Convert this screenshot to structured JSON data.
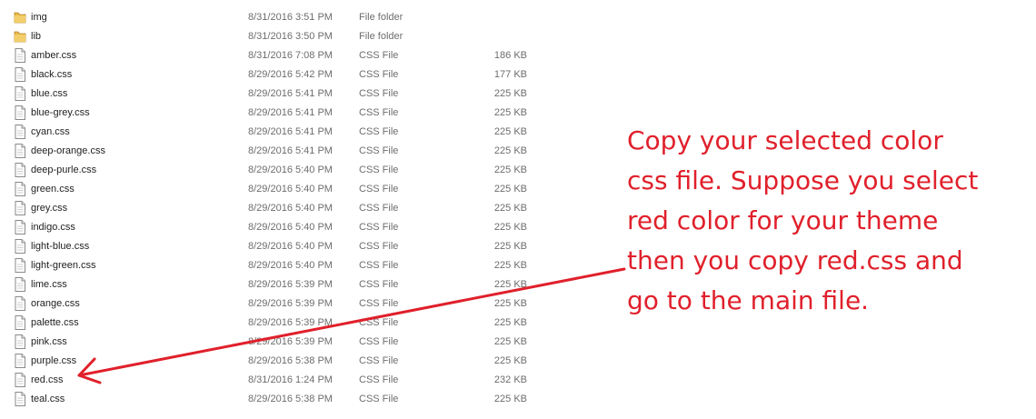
{
  "files": [
    {
      "name": "img",
      "date": "8/31/2016 3:51 PM",
      "type": "File folder",
      "size": "",
      "icon": "folder-icon"
    },
    {
      "name": "lib",
      "date": "8/31/2016 3:50 PM",
      "type": "File folder",
      "size": "",
      "icon": "folder-icon"
    },
    {
      "name": "amber.css",
      "date": "8/31/2016 7:08 PM",
      "type": "CSS File",
      "size": "186 KB",
      "icon": "file-icon"
    },
    {
      "name": "black.css",
      "date": "8/29/2016 5:42 PM",
      "type": "CSS File",
      "size": "177 KB",
      "icon": "file-icon"
    },
    {
      "name": "blue.css",
      "date": "8/29/2016 5:41 PM",
      "type": "CSS File",
      "size": "225 KB",
      "icon": "file-icon"
    },
    {
      "name": "blue-grey.css",
      "date": "8/29/2016 5:41 PM",
      "type": "CSS File",
      "size": "225 KB",
      "icon": "file-icon"
    },
    {
      "name": "cyan.css",
      "date": "8/29/2016 5:41 PM",
      "type": "CSS File",
      "size": "225 KB",
      "icon": "file-icon"
    },
    {
      "name": "deep-orange.css",
      "date": "8/29/2016 5:41 PM",
      "type": "CSS File",
      "size": "225 KB",
      "icon": "file-icon"
    },
    {
      "name": "deep-purle.css",
      "date": "8/29/2016 5:40 PM",
      "type": "CSS File",
      "size": "225 KB",
      "icon": "file-icon"
    },
    {
      "name": "green.css",
      "date": "8/29/2016 5:40 PM",
      "type": "CSS File",
      "size": "225 KB",
      "icon": "file-icon"
    },
    {
      "name": "grey.css",
      "date": "8/29/2016 5:40 PM",
      "type": "CSS File",
      "size": "225 KB",
      "icon": "file-icon"
    },
    {
      "name": "indigo.css",
      "date": "8/29/2016 5:40 PM",
      "type": "CSS File",
      "size": "225 KB",
      "icon": "file-icon"
    },
    {
      "name": "light-blue.css",
      "date": "8/29/2016 5:40 PM",
      "type": "CSS File",
      "size": "225 KB",
      "icon": "file-icon"
    },
    {
      "name": "light-green.css",
      "date": "8/29/2016 5:40 PM",
      "type": "CSS File",
      "size": "225 KB",
      "icon": "file-icon"
    },
    {
      "name": "lime.css",
      "date": "8/29/2016 5:39 PM",
      "type": "CSS File",
      "size": "225 KB",
      "icon": "file-icon"
    },
    {
      "name": "orange.css",
      "date": "8/29/2016 5:39 PM",
      "type": "CSS File",
      "size": "225 KB",
      "icon": "file-icon"
    },
    {
      "name": "palette.css",
      "date": "8/29/2016 5:39 PM",
      "type": "CSS File",
      "size": "225 KB",
      "icon": "file-icon"
    },
    {
      "name": "pink.css",
      "date": "8/29/2016 5:39 PM",
      "type": "CSS File",
      "size": "225 KB",
      "icon": "file-icon"
    },
    {
      "name": "purple.css",
      "date": "8/29/2016 5:38 PM",
      "type": "CSS File",
      "size": "225 KB",
      "icon": "file-icon"
    },
    {
      "name": "red.css",
      "date": "8/31/2016 1:24 PM",
      "type": "CSS File",
      "size": "232 KB",
      "icon": "file-icon"
    },
    {
      "name": "teal.css",
      "date": "8/29/2016 5:38 PM",
      "type": "CSS File",
      "size": "225 KB",
      "icon": "file-icon"
    }
  ],
  "annotation": {
    "lines": [
      "Copy your selected color",
      "css file. Suppose you select",
      "red color for your theme",
      "then you copy red.css and",
      "go to the main file."
    ],
    "color": "#e0202b",
    "points_to": "red.css"
  },
  "colors": {
    "folder": "#e8b84a",
    "annotation_red": "#e0202b",
    "secondary_text": "#6d6d6d"
  }
}
